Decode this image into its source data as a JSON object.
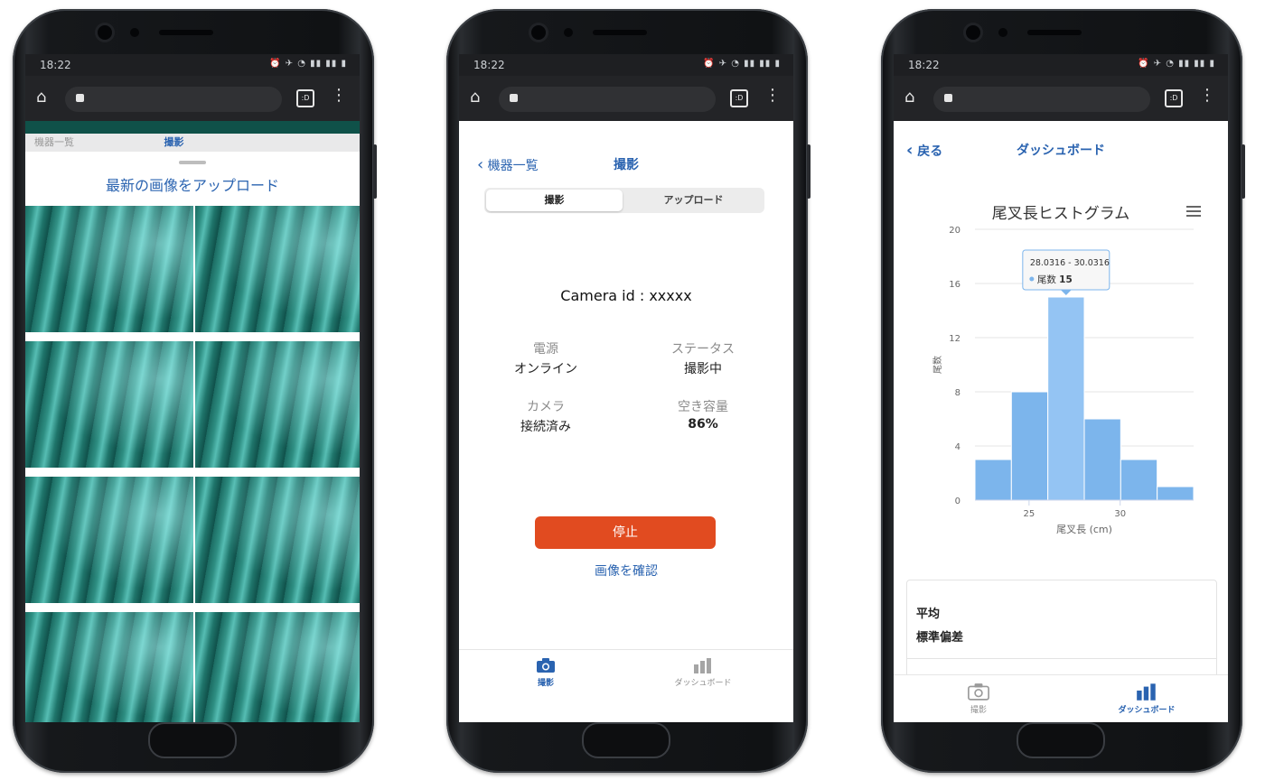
{
  "common": {
    "time": "18:22",
    "status_icons": "⏰ ✈ ◔ ▮▮ ▮▮ ▮",
    "tabs_glyph": ":D",
    "more_glyph": "⋮",
    "home_glyph": "⌂"
  },
  "phone1": {
    "header_back_hidden": "機器一覧",
    "header_title_hidden": "撮影",
    "sheet_title": "最新の画像をアップロード"
  },
  "phone2": {
    "back_label": "機器一覧",
    "title": "撮影",
    "segments": [
      "撮影",
      "アップロード"
    ],
    "camera_id": "Camera id : xxxxx",
    "stats": [
      {
        "label": "電源",
        "value": "オンライン"
      },
      {
        "label": "ステータス",
        "value": "撮影中"
      },
      {
        "label": "カメラ",
        "value": "接続済み"
      },
      {
        "label": "空き容量",
        "value": "86%"
      }
    ],
    "stop_label": "停止",
    "check_label": "画像を確認",
    "tabs": [
      "撮影",
      "ダッシュボード"
    ]
  },
  "phone3": {
    "back_label": "戻る",
    "title": "ダッシュボード",
    "stats": [
      "平均",
      "標準偏差"
    ],
    "tabs": [
      "撮影",
      "ダッシュボード"
    ]
  },
  "chart_data": {
    "type": "bar",
    "title": "尾叉長ヒストグラム",
    "xlabel": "尾叉長 (cm)",
    "ylabel": "尾数",
    "bins": [
      [
        22.0316,
        24.0316
      ],
      [
        24.0316,
        26.0316
      ],
      [
        26.0316,
        28.0316
      ],
      [
        28.0316,
        30.0316
      ],
      [
        30.0316,
        32.0316
      ],
      [
        32.0316,
        34.0316
      ]
    ],
    "values": [
      3,
      8,
      15,
      6,
      3,
      1
    ],
    "ylim": [
      0,
      20
    ],
    "yticks": [
      0,
      4,
      8,
      12,
      16,
      20
    ],
    "xticks": [
      25,
      30
    ],
    "tooltip": {
      "range": "28.0316 - 30.0316",
      "series": "尾数",
      "value": "15"
    },
    "colors": {
      "bar": "#7cb5ec",
      "highlight": "#94c4f3"
    }
  }
}
